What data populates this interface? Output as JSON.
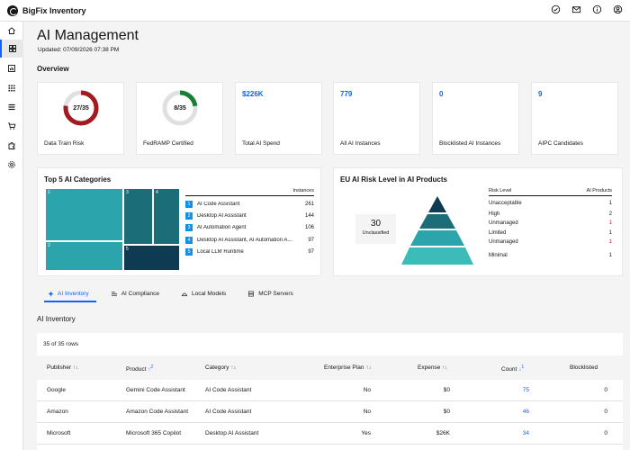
{
  "app": {
    "title": "BigFix Inventory"
  },
  "page": {
    "title": "AI Management",
    "updated": "Updated: 07/09/2026 07:38 PM",
    "overview_label": "Overview"
  },
  "kpis": [
    {
      "label": "Data Train Risk",
      "ring_text": "27/35",
      "ring_value": 27,
      "ring_total": 35,
      "color": "#a2191f"
    },
    {
      "label": "FedRAMP Certified",
      "ring_text": "8/35",
      "ring_value": 8,
      "ring_total": 35,
      "color": "#198038"
    },
    {
      "label": "Total AI Spend",
      "value": "$226K"
    },
    {
      "label": "All AI Instances",
      "value": "779"
    },
    {
      "label": "Blocklisted AI Instances",
      "value": "0"
    },
    {
      "label": "AIPC Candidates",
      "value": "9"
    }
  ],
  "categories": {
    "title": "Top 5 AI Categories",
    "column_header": "Instances",
    "items": [
      {
        "num": "1",
        "label": "AI Code Assistant",
        "value": "261"
      },
      {
        "num": "2",
        "label": "Desktop AI Assistant",
        "value": "144"
      },
      {
        "num": "3",
        "label": "AI Automation Agent",
        "value": "106"
      },
      {
        "num": "4",
        "label": "Desktop AI Assistant, AI Automation A...",
        "value": "97"
      },
      {
        "num": "5",
        "label": "Local LLM Runtime",
        "value": "97"
      }
    ]
  },
  "risk": {
    "title": "EU AI Risk Level in AI Products",
    "unclassified_count": "30",
    "unclassified_label": "Unclassified",
    "header_level": "Risk Level",
    "header_products": "AI Products",
    "rows": [
      {
        "label": "Unacceptable",
        "value": "1",
        "alert": false
      },
      {
        "label": "High",
        "value": "2",
        "alert": false
      },
      {
        "label": "Unmanaged",
        "value": "1",
        "alert": true
      },
      {
        "label": "Limited",
        "value": "1",
        "alert": false
      },
      {
        "label": "Unmanaged",
        "value": "1",
        "alert": true
      },
      {
        "label": "Minimal",
        "value": "1",
        "alert": false
      }
    ]
  },
  "tabs": [
    {
      "label": "AI Inventory",
      "active": true
    },
    {
      "label": "AI Compliance",
      "active": false
    },
    {
      "label": "Local Models",
      "active": false
    },
    {
      "label": "MCP Servers",
      "active": false
    }
  ],
  "inventory": {
    "title": "AI Inventory",
    "row_count": "35 of 35 rows",
    "columns": [
      "Publisher",
      "Product",
      "Category",
      "Enterprise Plan",
      "Expense",
      "Count",
      "Blocklisted"
    ],
    "product_sort_order": "2",
    "count_sort_order": "1",
    "rows": [
      [
        "Google",
        "Gemini Code Assistant",
        "AI Code Assistant",
        "No",
        "$0",
        "75",
        "0"
      ],
      [
        "Amazon",
        "Amazon Code Assistant",
        "AI Code Assistant",
        "No",
        "$0",
        "46",
        "0"
      ],
      [
        "Microsoft",
        "Microsoft 365 Copilot",
        "Desktop AI Assistant",
        "Yes",
        "$26K",
        "34",
        "0"
      ]
    ]
  }
}
